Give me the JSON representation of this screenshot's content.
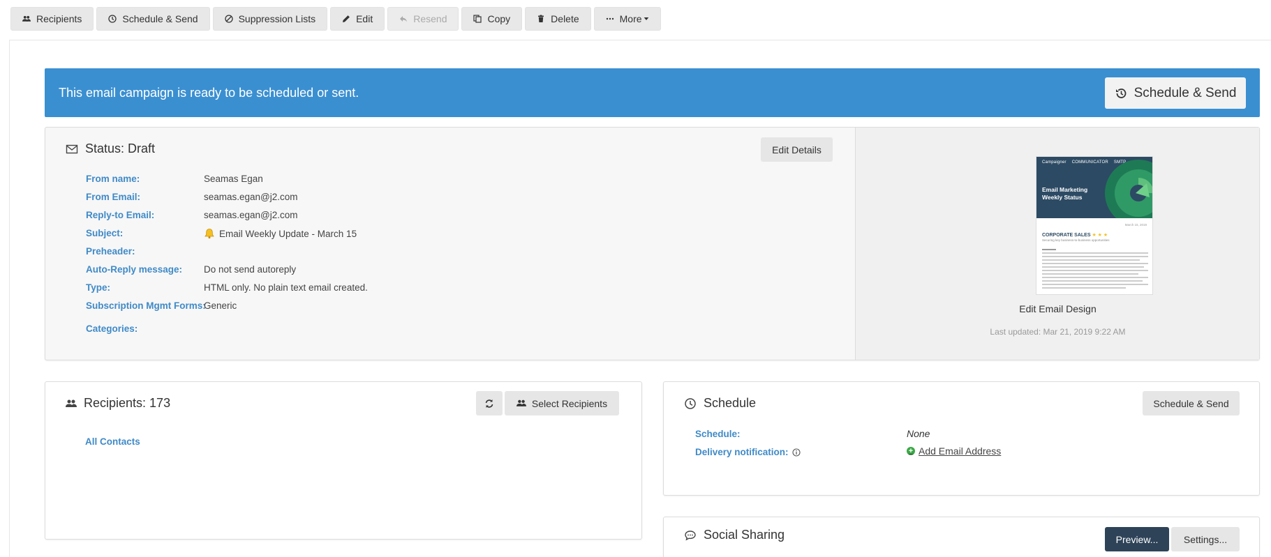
{
  "toolbar": {
    "recipients": "Recipients",
    "schedule_send": "Schedule & Send",
    "suppression_lists": "Suppression Lists",
    "edit": "Edit",
    "resend": "Resend",
    "copy": "Copy",
    "delete": "Delete",
    "more": "More"
  },
  "banner": {
    "message": "This email campaign is ready to be scheduled or sent.",
    "button": "Schedule & Send",
    "color": "#3a8fd1"
  },
  "status": {
    "title": "Status: Draft",
    "edit_details": "Edit Details",
    "fields": [
      {
        "label": "From name:",
        "value": "Seamas Egan"
      },
      {
        "label": "From Email:",
        "value": "seamas.egan@j2.com"
      },
      {
        "label": "Reply-to Email:",
        "value": "seamas.egan@j2.com"
      },
      {
        "label": "Subject:",
        "value": "Email Weekly Update - March 15",
        "icon": "bell-icon"
      },
      {
        "label": "Preheader:",
        "value": ""
      },
      {
        "label": "Auto-Reply message:",
        "value": "Do not send autoreply"
      },
      {
        "label": "Type:",
        "value": "HTML only. No plain text email created."
      },
      {
        "label": "Subscription Mgmt Forms:",
        "value": "Generic"
      },
      {
        "label": "Categories:",
        "value": ""
      }
    ]
  },
  "preview": {
    "logos": [
      "Campaigner",
      "COMMUNICATOR",
      "SMTP"
    ],
    "headline": "Email Marketing Weekly Status",
    "date": "March 15, 2019",
    "section": "CORPORATE SALES",
    "section_sub": "Securing key business-to-business opportunities",
    "caption": "Edit Email Design",
    "last_updated": "Last updated: Mar 21, 2019 9:22 AM"
  },
  "recipients": {
    "title": "Recipients: 173",
    "select_button": "Select Recipients",
    "list": [
      "All Contacts"
    ]
  },
  "schedule": {
    "title": "Schedule",
    "button": "Schedule & Send",
    "schedule_label": "Schedule:",
    "schedule_value": "None",
    "delivery_label": "Delivery notification:",
    "add_email": "Add Email Address"
  },
  "social": {
    "title": "Social Sharing",
    "preview_button": "Preview...",
    "settings_button": "Settings..."
  }
}
